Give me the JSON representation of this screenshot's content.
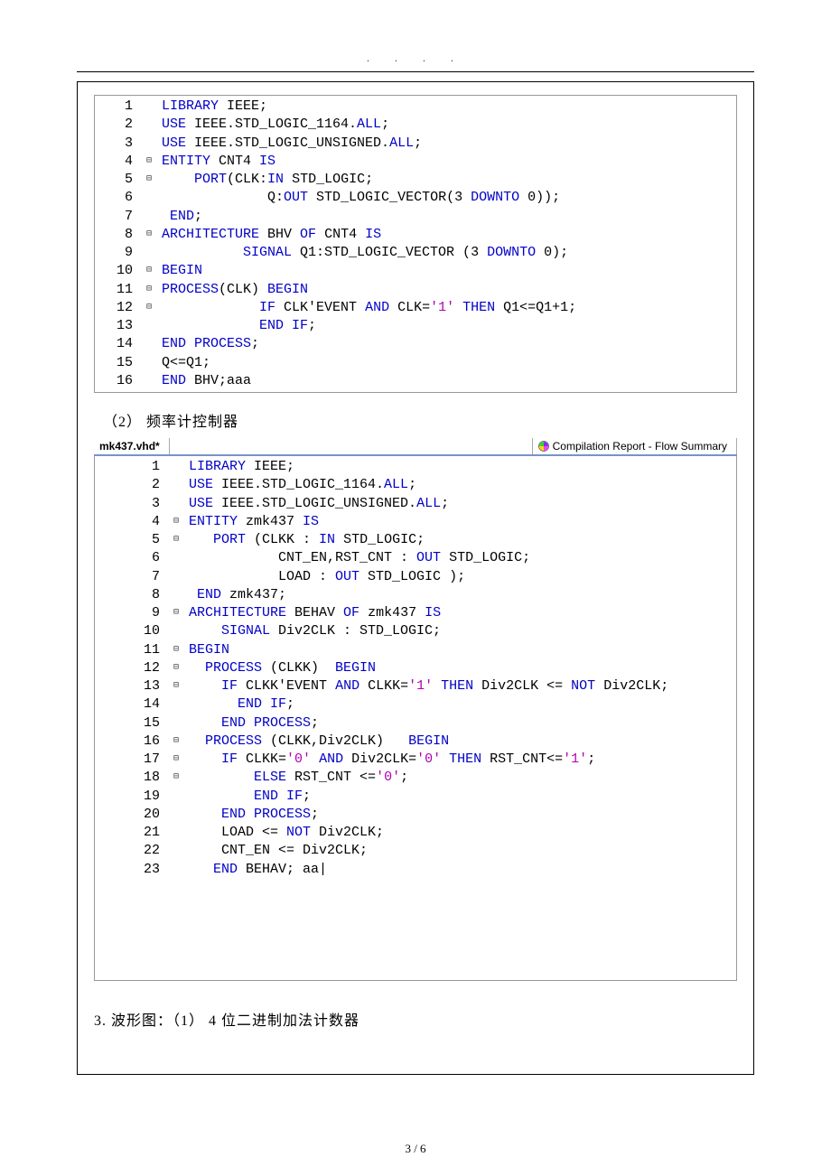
{
  "header_dots": "·  ·  ·  ·",
  "section2_label": "（2） 频率计控制器",
  "tab1_label": "mk437.vhd*",
  "tab2_label": "Compilation Report - Flow Summary",
  "bottom_heading": "3. 波形图：（1） 4 位二进制加法计数器",
  "page_number": "3 / 6",
  "code1": [
    {
      "n": "1",
      "f": "",
      "t": [
        {
          "c": "kw",
          "s": "LIBRARY"
        },
        {
          "c": "op",
          "s": " IEEE;"
        }
      ]
    },
    {
      "n": "2",
      "f": "",
      "t": [
        {
          "c": "kw",
          "s": "USE"
        },
        {
          "c": "op",
          "s": " IEEE.STD_LOGIC_1164."
        },
        {
          "c": "kw",
          "s": "ALL"
        },
        {
          "c": "op",
          "s": ";"
        }
      ]
    },
    {
      "n": "3",
      "f": "",
      "t": [
        {
          "c": "kw",
          "s": "USE"
        },
        {
          "c": "op",
          "s": " IEEE.STD_LOGIC_UNSIGNED."
        },
        {
          "c": "kw",
          "s": "ALL"
        },
        {
          "c": "op",
          "s": ";"
        }
      ]
    },
    {
      "n": "4",
      "f": "⊟",
      "t": [
        {
          "c": "kw",
          "s": "ENTITY"
        },
        {
          "c": "op",
          "s": " CNT4 "
        },
        {
          "c": "kw",
          "s": "IS"
        }
      ]
    },
    {
      "n": "5",
      "f": "⊟",
      "t": [
        {
          "c": "op",
          "s": "    "
        },
        {
          "c": "kw",
          "s": "PORT"
        },
        {
          "c": "op",
          "s": "(CLK:"
        },
        {
          "c": "kw",
          "s": "IN"
        },
        {
          "c": "op",
          "s": " STD_LOGIC;"
        }
      ]
    },
    {
      "n": "6",
      "f": "",
      "t": [
        {
          "c": "op",
          "s": "             Q:"
        },
        {
          "c": "kw",
          "s": "OUT"
        },
        {
          "c": "op",
          "s": " STD_LOGIC_VECTOR(3 "
        },
        {
          "c": "kw",
          "s": "DOWNTO"
        },
        {
          "c": "op",
          "s": " 0));"
        }
      ]
    },
    {
      "n": "7",
      "f": "",
      "t": [
        {
          "c": "op",
          "s": " "
        },
        {
          "c": "kw",
          "s": "END"
        },
        {
          "c": "op",
          "s": ";"
        }
      ]
    },
    {
      "n": "8",
      "f": "⊟",
      "t": [
        {
          "c": "kw",
          "s": "ARCHITECTURE"
        },
        {
          "c": "op",
          "s": " BHV "
        },
        {
          "c": "kw",
          "s": "OF"
        },
        {
          "c": "op",
          "s": " CNT4 "
        },
        {
          "c": "kw",
          "s": "IS"
        }
      ]
    },
    {
      "n": "9",
      "f": "",
      "t": [
        {
          "c": "op",
          "s": "          "
        },
        {
          "c": "kw",
          "s": "SIGNAL"
        },
        {
          "c": "op",
          "s": " Q1:STD_LOGIC_VECTOR (3 "
        },
        {
          "c": "kw",
          "s": "DOWNTO"
        },
        {
          "c": "op",
          "s": " 0);"
        }
      ]
    },
    {
      "n": "10",
      "f": "⊟",
      "t": [
        {
          "c": "kw",
          "s": "BEGIN"
        }
      ]
    },
    {
      "n": "11",
      "f": "⊟",
      "t": [
        {
          "c": "kw",
          "s": "PROCESS"
        },
        {
          "c": "op",
          "s": "(CLK) "
        },
        {
          "c": "kw",
          "s": "BEGIN"
        }
      ]
    },
    {
      "n": "12",
      "f": "⊟",
      "t": [
        {
          "c": "op",
          "s": "            "
        },
        {
          "c": "kw",
          "s": "IF"
        },
        {
          "c": "op",
          "s": " CLK'EVENT "
        },
        {
          "c": "kw",
          "s": "AND"
        },
        {
          "c": "op",
          "s": " CLK="
        },
        {
          "c": "str",
          "s": "'1'"
        },
        {
          "c": "op",
          "s": " "
        },
        {
          "c": "kw",
          "s": "THEN"
        },
        {
          "c": "op",
          "s": " Q1<=Q1+1;"
        }
      ]
    },
    {
      "n": "13",
      "f": "",
      "t": [
        {
          "c": "op",
          "s": "            "
        },
        {
          "c": "kw",
          "s": "END IF"
        },
        {
          "c": "op",
          "s": ";"
        }
      ]
    },
    {
      "n": "14",
      "f": "",
      "t": [
        {
          "c": "kw",
          "s": "END PROCESS"
        },
        {
          "c": "op",
          "s": ";"
        }
      ]
    },
    {
      "n": "15",
      "f": "",
      "t": [
        {
          "c": "op",
          "s": "Q<=Q1;"
        }
      ]
    },
    {
      "n": "16",
      "f": "",
      "t": [
        {
          "c": "kw",
          "s": "END"
        },
        {
          "c": "op",
          "s": " BHV;aaa"
        }
      ]
    }
  ],
  "code2": [
    {
      "n": "1",
      "f": "",
      "t": [
        {
          "c": "kw",
          "s": "LIBRARY"
        },
        {
          "c": "op",
          "s": " IEEE;"
        }
      ]
    },
    {
      "n": "2",
      "f": "",
      "t": [
        {
          "c": "kw",
          "s": "USE"
        },
        {
          "c": "op",
          "s": " IEEE.STD_LOGIC_1164."
        },
        {
          "c": "kw",
          "s": "ALL"
        },
        {
          "c": "op",
          "s": ";"
        }
      ]
    },
    {
      "n": "3",
      "f": "",
      "t": [
        {
          "c": "kw",
          "s": "USE"
        },
        {
          "c": "op",
          "s": " IEEE.STD_LOGIC_UNSIGNED."
        },
        {
          "c": "kw",
          "s": "ALL"
        },
        {
          "c": "op",
          "s": ";"
        }
      ]
    },
    {
      "n": "4",
      "f": "⊟",
      "t": [
        {
          "c": "kw",
          "s": "ENTITY"
        },
        {
          "c": "op",
          "s": " zmk437 "
        },
        {
          "c": "kw",
          "s": "IS"
        }
      ]
    },
    {
      "n": "5",
      "f": "⊟",
      "t": [
        {
          "c": "op",
          "s": "   "
        },
        {
          "c": "kw",
          "s": "PORT"
        },
        {
          "c": "op",
          "s": " (CLKK : "
        },
        {
          "c": "kw",
          "s": "IN"
        },
        {
          "c": "op",
          "s": " STD_LOGIC;"
        }
      ]
    },
    {
      "n": "6",
      "f": "",
      "t": [
        {
          "c": "op",
          "s": "           CNT_EN,RST_CNT : "
        },
        {
          "c": "kw",
          "s": "OUT"
        },
        {
          "c": "op",
          "s": " STD_LOGIC;"
        }
      ]
    },
    {
      "n": "7",
      "f": "",
      "t": [
        {
          "c": "op",
          "s": "           LOAD : "
        },
        {
          "c": "kw",
          "s": "OUT"
        },
        {
          "c": "op",
          "s": " STD_LOGIC );"
        }
      ]
    },
    {
      "n": "8",
      "f": "",
      "t": [
        {
          "c": "op",
          "s": " "
        },
        {
          "c": "kw",
          "s": "END"
        },
        {
          "c": "op",
          "s": " zmk437;"
        }
      ]
    },
    {
      "n": "9",
      "f": "⊟",
      "t": [
        {
          "c": "kw",
          "s": "ARCHITECTURE"
        },
        {
          "c": "op",
          "s": " BEHAV "
        },
        {
          "c": "kw",
          "s": "OF"
        },
        {
          "c": "op",
          "s": " zmk437 "
        },
        {
          "c": "kw",
          "s": "IS"
        }
      ]
    },
    {
      "n": "10",
      "f": "",
      "t": [
        {
          "c": "op",
          "s": "    "
        },
        {
          "c": "kw",
          "s": "SIGNAL"
        },
        {
          "c": "op",
          "s": " Div2CLK : STD_LOGIC;"
        }
      ]
    },
    {
      "n": "11",
      "f": "⊟",
      "t": [
        {
          "c": "kw",
          "s": "BEGIN"
        }
      ]
    },
    {
      "n": "12",
      "f": "⊟",
      "t": [
        {
          "c": "op",
          "s": "  "
        },
        {
          "c": "kw",
          "s": "PROCESS"
        },
        {
          "c": "op",
          "s": " (CLKK)  "
        },
        {
          "c": "kw",
          "s": "BEGIN"
        }
      ]
    },
    {
      "n": "13",
      "f": "⊟",
      "t": [
        {
          "c": "op",
          "s": "    "
        },
        {
          "c": "kw",
          "s": "IF"
        },
        {
          "c": "op",
          "s": " CLKK'EVENT "
        },
        {
          "c": "kw",
          "s": "AND"
        },
        {
          "c": "op",
          "s": " CLKK="
        },
        {
          "c": "str",
          "s": "'1'"
        },
        {
          "c": "op",
          "s": " "
        },
        {
          "c": "kw",
          "s": "THEN"
        },
        {
          "c": "op",
          "s": " Div2CLK <= "
        },
        {
          "c": "kw",
          "s": "NOT"
        },
        {
          "c": "op",
          "s": " Div2CLK;"
        }
      ]
    },
    {
      "n": "14",
      "f": "",
      "t": [
        {
          "c": "op",
          "s": "      "
        },
        {
          "c": "kw",
          "s": "END IF"
        },
        {
          "c": "op",
          "s": ";"
        }
      ]
    },
    {
      "n": "15",
      "f": "",
      "t": [
        {
          "c": "op",
          "s": "    "
        },
        {
          "c": "kw",
          "s": "END PROCESS"
        },
        {
          "c": "op",
          "s": ";"
        }
      ]
    },
    {
      "n": "16",
      "f": "⊟",
      "t": [
        {
          "c": "op",
          "s": "  "
        },
        {
          "c": "kw",
          "s": "PROCESS"
        },
        {
          "c": "op",
          "s": " (CLKK,Div2CLK)   "
        },
        {
          "c": "kw",
          "s": "BEGIN"
        }
      ]
    },
    {
      "n": "17",
      "f": "⊟",
      "t": [
        {
          "c": "op",
          "s": "    "
        },
        {
          "c": "kw",
          "s": "IF"
        },
        {
          "c": "op",
          "s": " CLKK="
        },
        {
          "c": "str",
          "s": "'0'"
        },
        {
          "c": "op",
          "s": " "
        },
        {
          "c": "kw",
          "s": "AND"
        },
        {
          "c": "op",
          "s": " Div2CLK="
        },
        {
          "c": "str",
          "s": "'0'"
        },
        {
          "c": "op",
          "s": " "
        },
        {
          "c": "kw",
          "s": "THEN"
        },
        {
          "c": "op",
          "s": " RST_CNT<="
        },
        {
          "c": "str",
          "s": "'1'"
        },
        {
          "c": "op",
          "s": ";"
        }
      ]
    },
    {
      "n": "18",
      "f": "⊟",
      "t": [
        {
          "c": "op",
          "s": "        "
        },
        {
          "c": "kw",
          "s": "ELSE"
        },
        {
          "c": "op",
          "s": " RST_CNT <="
        },
        {
          "c": "str",
          "s": "'0'"
        },
        {
          "c": "op",
          "s": ";"
        }
      ]
    },
    {
      "n": "19",
      "f": "",
      "t": [
        {
          "c": "op",
          "s": "        "
        },
        {
          "c": "kw",
          "s": "END IF"
        },
        {
          "c": "op",
          "s": ";"
        }
      ]
    },
    {
      "n": "20",
      "f": "",
      "t": [
        {
          "c": "op",
          "s": "    "
        },
        {
          "c": "kw",
          "s": "END PROCESS"
        },
        {
          "c": "op",
          "s": ";"
        }
      ]
    },
    {
      "n": "21",
      "f": "",
      "t": [
        {
          "c": "op",
          "s": "    LOAD <= "
        },
        {
          "c": "kw",
          "s": "NOT"
        },
        {
          "c": "op",
          "s": " Div2CLK;"
        }
      ]
    },
    {
      "n": "22",
      "f": "",
      "t": [
        {
          "c": "op",
          "s": "    CNT_EN <= Div2CLK;"
        }
      ]
    },
    {
      "n": "23",
      "f": "",
      "t": [
        {
          "c": "op",
          "s": "   "
        },
        {
          "c": "kw",
          "s": "END"
        },
        {
          "c": "op",
          "s": " BEHAV; aa|"
        }
      ]
    }
  ]
}
